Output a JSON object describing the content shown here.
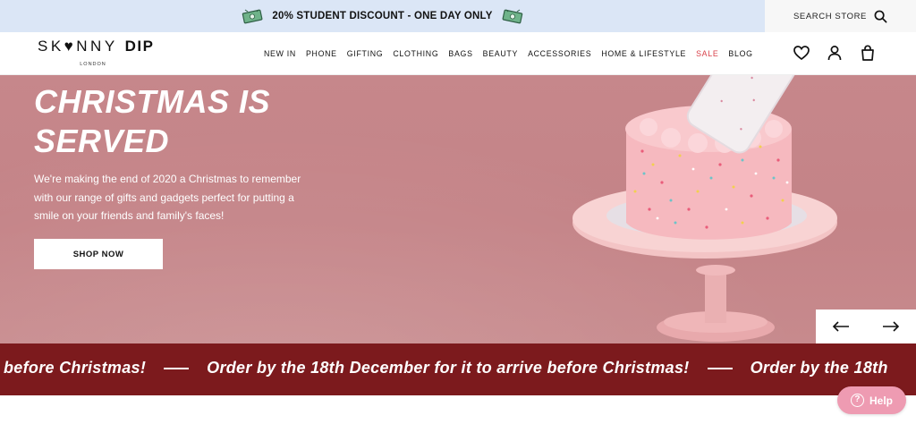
{
  "promo": {
    "text": "20% STUDENT DISCOUNT - ONE DAY ONLY",
    "icon_left": "cash-icon",
    "icon_right": "cash-icon"
  },
  "search": {
    "label": "SEARCH STORE",
    "icon": "search-icon"
  },
  "logo": {
    "brand_light": "SK♥NNY",
    "brand_bold": "DIP",
    "sub": "LONDON"
  },
  "nav": {
    "items": [
      {
        "label": "NEW IN"
      },
      {
        "label": "PHONE"
      },
      {
        "label": "GIFTING"
      },
      {
        "label": "CLOTHING"
      },
      {
        "label": "BAGS"
      },
      {
        "label": "BEAUTY"
      },
      {
        "label": "ACCESSORIES"
      },
      {
        "label": "HOME & LIFESTYLE"
      },
      {
        "label": "SALE"
      },
      {
        "label": "BLOG"
      }
    ]
  },
  "header_icons": [
    "heart-icon",
    "user-icon",
    "bag-icon"
  ],
  "hero": {
    "title_line1": "CHRISTMAS IS",
    "title_line2": "SERVED",
    "body": "We're making the end of 2020 a Christmas to remember with our range of gifts and gadgets perfect for putting a smile on your friends and family's faces!",
    "cta": "SHOP NOW"
  },
  "carousel": {
    "prev_icon": "arrow-left-icon",
    "next_icon": "arrow-right-icon"
  },
  "marquee": {
    "segments": [
      "before Christmas!",
      "Order by the 18th December for it to arrive before Christmas!",
      "Order by the 18th"
    ]
  },
  "help": {
    "label": "Help",
    "icon_glyph": "?"
  },
  "colors": {
    "promo_bg": "#dbe6f6",
    "hero_bg": "#c6878b",
    "marquee_bg": "#7c1a1d",
    "sale": "#d9424b",
    "help_bg": "#ee9bb2"
  }
}
